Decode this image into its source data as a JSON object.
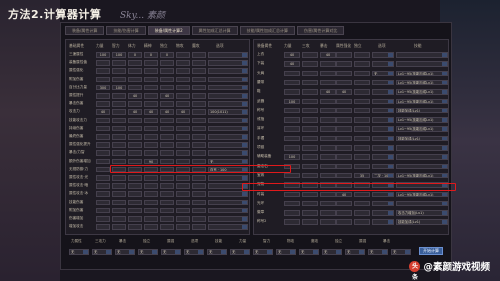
{
  "heading": "方法2.计算器计算",
  "watermark_top": "Sky... 素颜",
  "watermark_bottom": {
    "circle": "头条",
    "text": "@素颜游戏视频"
  },
  "tabs": [
    "装备/属性计算",
    "技能/伤害计算",
    "装备/属性计算2",
    "属性加成汇总计算",
    "技能/属性加成汇总计算",
    "伤害/属性计算对比"
  ],
  "active_tab": 2,
  "left_panel": {
    "headers": [
      "基础属性",
      "力量",
      "智力",
      "体力",
      "精神",
      "独立",
      "物攻",
      "魔攻",
      "选项"
    ],
    "rows": [
      {
        "label": "三速属性",
        "values": [
          "100",
          "100",
          "0",
          "0",
          "0",
          "",
          "",
          ""
        ]
      },
      {
        "label": "装备属性值",
        "values": [
          "",
          "",
          "",
          "",
          "",
          "",
          "",
          ""
        ]
      },
      {
        "label": "属性强化",
        "values": [
          "",
          "",
          "",
          "",
          "",
          "",
          "",
          ""
        ]
      },
      {
        "label": "附加伤害",
        "values": [
          "",
          "",
          "",
          "",
          "",
          "",
          "",
          ""
        ]
      },
      {
        "label": "百分比力量",
        "values": [
          "300",
          "100",
          "",
          "",
          "",
          "",
          "",
          ""
        ]
      },
      {
        "label": "属性提升",
        "values": [
          "",
          "",
          "40",
          "",
          "40",
          "",
          "",
          ""
        ]
      },
      {
        "label": "暴击伤害",
        "values": [
          "",
          "",
          "",
          "",
          "",
          "",
          "",
          ""
        ]
      },
      {
        "label": "攻击力",
        "values": [
          "40",
          "",
          "40",
          "40",
          "40",
          "40",
          "",
          "100(1011)"
        ]
      },
      {
        "label": "技能攻击力",
        "values": [
          "",
          "",
          "",
          "",
          "",
          "",
          "",
          ""
        ]
      },
      {
        "label": "持续伤害",
        "values": [
          "",
          "",
          "",
          "",
          "",
          "",
          "",
          ""
        ]
      },
      {
        "label": "最终伤害",
        "values": [
          "",
          "",
          "",
          "",
          "",
          "",
          "",
          ""
        ]
      },
      {
        "label": "属性强化提升",
        "values": [
          "",
          "",
          "",
          "",
          "",
          "",
          "",
          ""
        ]
      },
      {
        "label": "暴击/力智",
        "values": [
          "",
          "",
          "",
          "",
          "",
          "",
          "",
          ""
        ]
      },
      {
        "label": "额外伤害增加",
        "values": [
          "",
          "",
          "",
          "90",
          "",
          "",
          "",
          "无"
        ]
      },
      {
        "label": "无视防御·力",
        "values": [
          "",
          "",
          "",
          "",
          "",
          "",
          "",
          "自充 · 100"
        ]
      },
      {
        "label": "属性攻击·光",
        "values": [
          "",
          "",
          "",
          "",
          "",
          "",
          "",
          ""
        ]
      },
      {
        "label": "属性攻击·暗",
        "values": [
          "",
          "",
          "",
          "",
          "",
          "",
          "",
          ""
        ]
      },
      {
        "label": "属性攻击·冰",
        "values": [
          "",
          "",
          "",
          "",
          "",
          "",
          "",
          ""
        ]
      },
      {
        "label": "技能伤害",
        "values": [
          "",
          "",
          "",
          "",
          "",
          "",
          "",
          ""
        ]
      },
      {
        "label": "附加伤害",
        "values": [
          "",
          "",
          "",
          "",
          "",
          "",
          "",
          ""
        ]
      },
      {
        "label": "伤害增加",
        "values": [
          "",
          "",
          "",
          "",
          "",
          "",
          "",
          ""
        ]
      },
      {
        "label": "增加攻击",
        "values": [
          "",
          "",
          "",
          "",
          "",
          "",
          "",
          ""
        ]
      }
    ]
  },
  "right_panel": {
    "headers": [
      "装备属性",
      "力量",
      "三攻",
      "暴击",
      "属性强化",
      "独立",
      "选项",
      "技能"
    ],
    "rows": [
      {
        "label": "上衣",
        "values": [
          "40",
          "",
          "40",
          "",
          "",
          "",
          ""
        ]
      },
      {
        "label": "下装",
        "values": [
          "40",
          "",
          "",
          "",
          "",
          "",
          ""
        ]
      },
      {
        "label": "头肩",
        "values": [
          "",
          "",
          "",
          "",
          "",
          "无",
          "Lv1~95(技能加成Lv1)"
        ]
      },
      {
        "label": "腰带",
        "values": [
          "",
          "",
          "",
          "",
          "",
          "",
          "Lv1~95(技能加成Lv1)"
        ]
      },
      {
        "label": "鞋",
        "values": [
          "",
          "",
          "40",
          "40",
          "",
          "",
          "Lv1~95(技能加成Lv1)"
        ]
      },
      {
        "label": "武器",
        "values": [
          "100",
          "",
          "",
          "",
          "",
          "",
          "Lv1~95(技能加成Lv1)"
        ]
      },
      {
        "label": "称号",
        "values": [
          "",
          "",
          "",
          "",
          "",
          "",
          "技能加成(Lv1)"
        ]
      },
      {
        "label": "戒指",
        "values": [
          "",
          "",
          "",
          "",
          "",
          "",
          "Lv1~95(技能加成Lv1)"
        ]
      },
      {
        "label": "耳环",
        "values": [
          "",
          "",
          "",
          "",
          "",
          "",
          "Lv1~95(技能加成Lv1)"
        ]
      },
      {
        "label": "手镯",
        "values": [
          "",
          "",
          "",
          "",
          "",
          "",
          "技能加成(Lv1)"
        ]
      },
      {
        "label": "项链",
        "values": [
          "",
          "",
          "",
          "",
          "",
          "",
          ""
        ]
      },
      {
        "label": "辅助装备",
        "values": [
          "100",
          "",
          "",
          "",
          "",
          "",
          ""
        ]
      },
      {
        "label": "魔法石",
        "values": [
          "",
          "",
          "",
          "",
          "",
          "",
          ""
        ]
      },
      {
        "label": "宝珠",
        "values": [
          "",
          "",
          "",
          "",
          "35",
          "二次 · 100",
          "Lv1~95(技能加成Lv1)"
        ]
      },
      {
        "label": "宠物",
        "values": [
          "",
          "",
          "",
          "",
          "",
          "",
          ""
        ]
      },
      {
        "label": "时装",
        "values": [
          "",
          "",
          "",
          "40",
          "",
          "",
          "Lv1~95(技能加成Lv1)"
        ]
      },
      {
        "label": "光环",
        "values": [
          "",
          "",
          "",
          "",
          "",
          "",
          ""
        ]
      },
      {
        "label": "徽章",
        "values": [
          "",
          "",
          "",
          "",
          "",
          "",
          "攻击力增加(Lv1)"
        ]
      },
      {
        "label": "称号2",
        "values": [
          "",
          "",
          "",
          "",
          "",
          "",
          "技能加成(Lv1)"
        ]
      }
    ]
  },
  "bottom": {
    "headers": [
      "力属性",
      "三攻力",
      "暴击",
      "独立",
      "属强",
      "选项",
      "技能",
      "力量",
      "智力",
      "物攻",
      "魔攻",
      "独立",
      "属强",
      "暴击"
    ],
    "selects": [
      "无",
      "无",
      "无",
      "无",
      "无",
      "无",
      "无",
      "无",
      "无",
      "无",
      "无",
      "无",
      "无",
      "无",
      "无"
    ],
    "calc_button": "开始计算"
  },
  "colors": {
    "highlight": "#e0191b",
    "accent_blue": "#3b4b6e"
  }
}
